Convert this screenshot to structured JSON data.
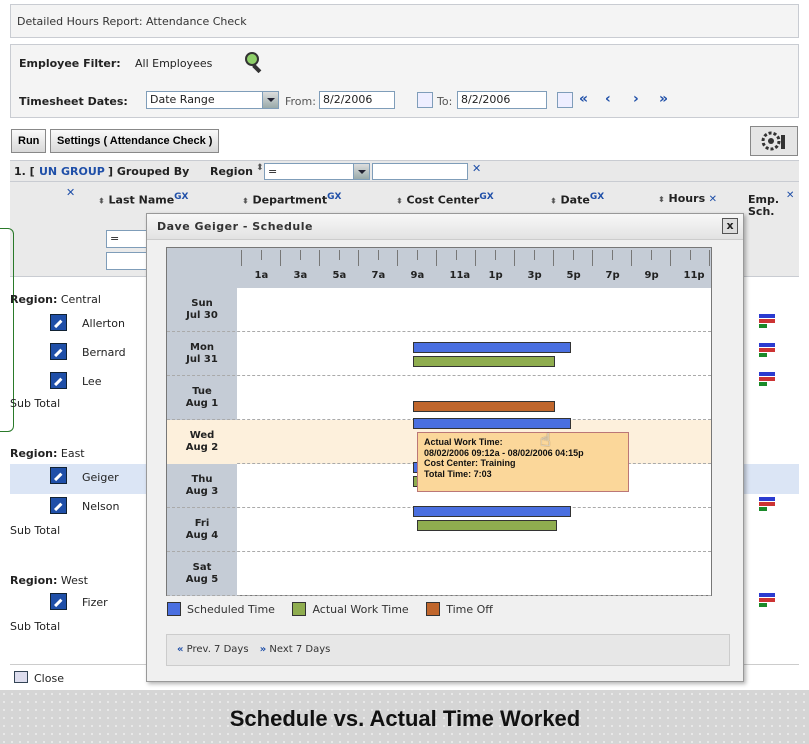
{
  "report_title": "Detailed Hours Report: Attendance Check",
  "filters": {
    "employee_filter_label": "Employee Filter:",
    "employee_filter_value": "All Employees",
    "timesheet_label": "Timesheet Dates:",
    "date_range_value": "Date Range",
    "from_label": "From:",
    "from_value": "8/2/2006",
    "to_label": "To:",
    "to_value": "8/2/2006",
    "nav": [
      "«",
      "‹",
      "›",
      "»"
    ]
  },
  "toolbar": {
    "run_label": "Run",
    "settings_label": "Settings ( Attendance Check )"
  },
  "group": {
    "prefix": "1. [",
    "ungroup_label": "UN GROUP",
    "suffix": "] Grouped By",
    "group_field": "Region",
    "operator_value": "="
  },
  "columns": [
    {
      "label": "Last Name"
    },
    {
      "label": "Department"
    },
    {
      "label": "Cost Center"
    },
    {
      "label": "Date"
    },
    {
      "label": "Hours"
    },
    {
      "label": "Emp. Sch."
    }
  ],
  "gx_label": "GX",
  "filter_operator": "=",
  "regions": [
    {
      "label": "Region:",
      "name": "Central",
      "employees": [
        "Allerton",
        "Bernard",
        "Lee"
      ],
      "subtotal": "Sub Total"
    },
    {
      "label": "Region:",
      "name": "East",
      "employees": [
        "Geiger",
        "Nelson"
      ],
      "subtotal": "Sub Total"
    },
    {
      "label": "Region:",
      "name": "West",
      "employees": [
        "Fizer"
      ],
      "subtotal": "Sub Total"
    }
  ],
  "close_label": "Close",
  "popup": {
    "title": "Dave Geiger - Schedule",
    "close_glyph": "x",
    "hours": [
      "1a",
      "3a",
      "5a",
      "7a",
      "9a",
      "11a",
      "1p",
      "3p",
      "5p",
      "7p",
      "9p",
      "11p"
    ],
    "days": [
      {
        "dow": "Sun",
        "date": "Jul 30"
      },
      {
        "dow": "Mon",
        "date": "Jul 31"
      },
      {
        "dow": "Tue",
        "date": "Aug 1"
      },
      {
        "dow": "Wed",
        "date": "Aug 2"
      },
      {
        "dow": "Thu",
        "date": "Aug 3"
      },
      {
        "dow": "Fri",
        "date": "Aug 4"
      },
      {
        "dow": "Sat",
        "date": "Aug 5"
      }
    ],
    "legend": [
      {
        "label": "Scheduled Time",
        "color": "#4a6fe0"
      },
      {
        "label": "Actual Work Time",
        "color": "#8fad4f"
      },
      {
        "label": "Time Off",
        "color": "#c0662c"
      }
    ],
    "prev_label": "Prev. 7 Days",
    "next_label": "Next 7 Days",
    "tooltip": {
      "title": "Actual Work Time:",
      "range": "08/02/2006 09:12a - 08/02/2006 04:15p",
      "cost_center": "Cost Center: Training",
      "total": "Total Time: 7:03"
    }
  },
  "banner": "Schedule vs. Actual Time Worked"
}
